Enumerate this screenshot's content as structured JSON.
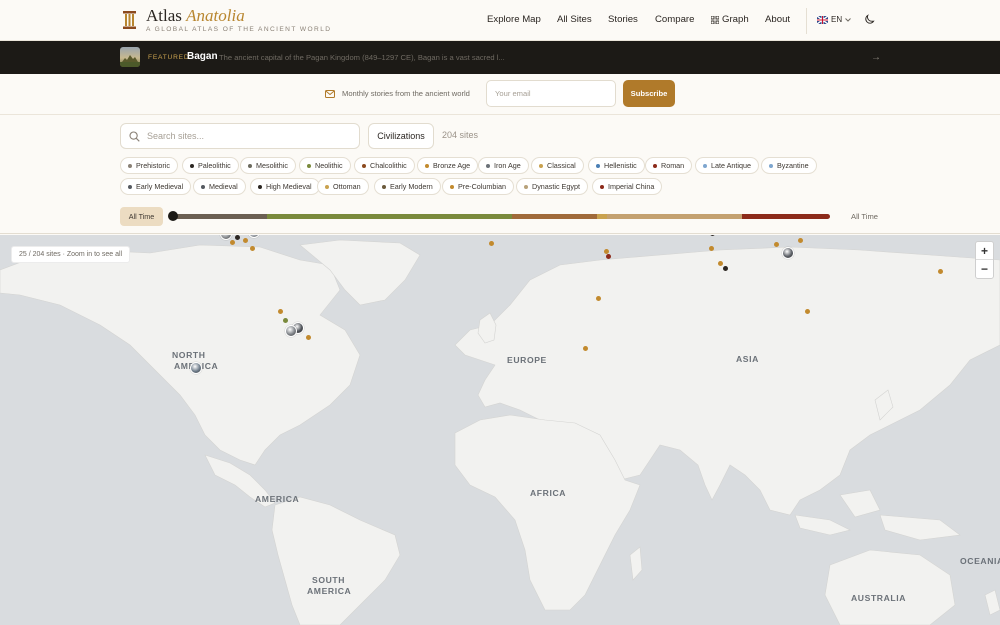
{
  "header": {
    "brand_main": "Atlas",
    "brand_accent": "Anatolia",
    "tagline": "A GLOBAL ATLAS OF THE ANCIENT WORLD",
    "nav": [
      "Explore Map",
      "All Sites",
      "Stories",
      "Compare",
      "Graph",
      "About"
    ],
    "lang": "EN"
  },
  "featured": {
    "label": "FEATURED",
    "title": "Bagan",
    "description": "The ancient capital of the Pagan Kingdom (849–1297 CE), Bagan is a vast sacred l..."
  },
  "newsletter": {
    "text": "Monthly stories from the ancient world",
    "placeholder": "Your email",
    "button": "Subscribe"
  },
  "filters": {
    "search_placeholder": "Search sites...",
    "civilizations_label": "Civilizations",
    "site_count": "204 sites",
    "periods": [
      {
        "label": "Prehistoric",
        "color": "#8a8176"
      },
      {
        "label": "Paleolithic",
        "color": "#2b2622"
      },
      {
        "label": "Mesolithic",
        "color": "#6b6a5e"
      },
      {
        "label": "Neolithic",
        "color": "#7a8a3c"
      },
      {
        "label": "Chalcolithic",
        "color": "#8c4a1e"
      },
      {
        "label": "Bronze Age",
        "color": "#c28a2e"
      },
      {
        "label": "Iron Age",
        "color": "#6b7178"
      },
      {
        "label": "Classical",
        "color": "#c9a24f"
      },
      {
        "label": "Hellenistic",
        "color": "#4a7fb5"
      },
      {
        "label": "Roman",
        "color": "#8c2a1a"
      },
      {
        "label": "Late Antique",
        "color": "#7ea6cf"
      },
      {
        "label": "Byzantine",
        "color": "#7ea6cf"
      },
      {
        "label": "Early Medieval",
        "color": "#555a60"
      },
      {
        "label": "Medieval",
        "color": "#555a60"
      },
      {
        "label": "High Medieval",
        "color": "#2b2622"
      },
      {
        "label": "Ottoman",
        "color": "#c9a24f"
      },
      {
        "label": "Early Modern",
        "color": "#6b5a3c"
      },
      {
        "label": "Pre-Columbian",
        "color": "#c28a2e"
      },
      {
        "label": "Dynastic Egypt",
        "color": "#b8a27a"
      },
      {
        "label": "Imperial China",
        "color": "#8c2a1a"
      }
    ],
    "all_time_button": "All Time",
    "all_time_label": "All Time"
  },
  "map": {
    "note": "25 / 204 sites · Zoom in to see all",
    "zoom_in": "+",
    "zoom_out": "−",
    "regions": [
      "NORTH",
      "AMERICA",
      "EUROPE",
      "ASIA",
      "AFRICA",
      "AMERICA",
      "SOUTH",
      "AMERICA",
      "AUSTRALIA",
      "OCEANIA"
    ]
  }
}
